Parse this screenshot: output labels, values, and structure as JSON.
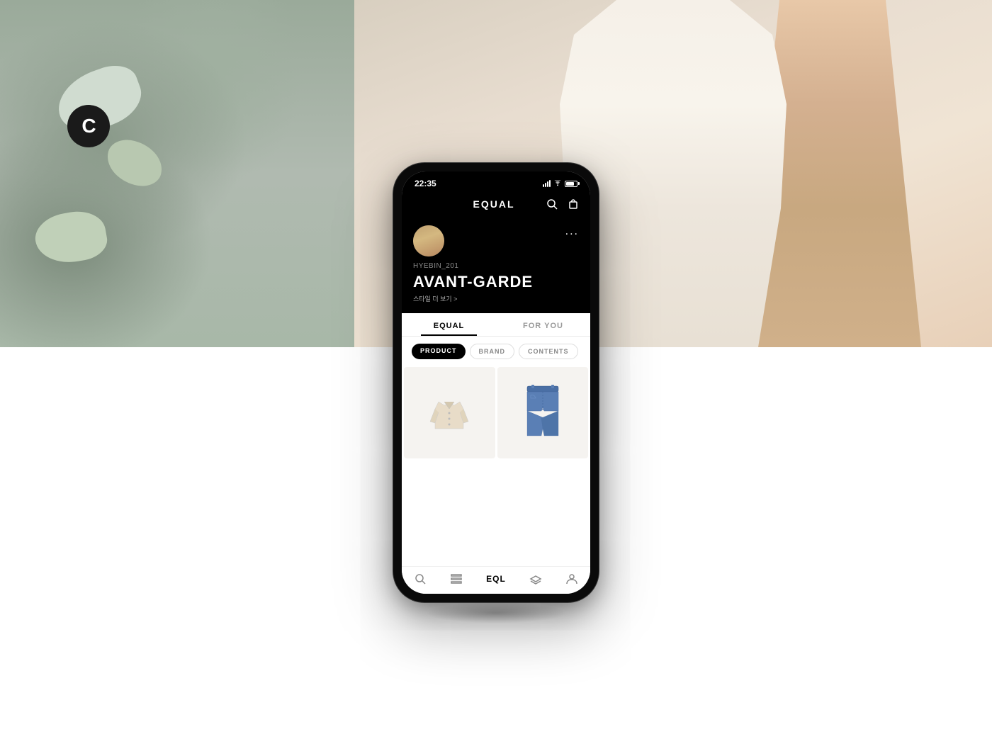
{
  "hero": {
    "background_desc": "Fashion editorial background with peeling concrete wall and person in white dress"
  },
  "c_logo": {
    "letter": "C"
  },
  "phone": {
    "status_bar": {
      "time": "22:35"
    },
    "app_header": {
      "title": "EQUAL",
      "search_label": "search",
      "cart_label": "cart"
    },
    "profile": {
      "username": "HYEBIN_201",
      "style_name": "AVANT-GARDE",
      "view_more": "스타일 더 보기 >",
      "more_options": "..."
    },
    "tabs": [
      {
        "label": "EQUAL",
        "active": true
      },
      {
        "label": "FOR YOU",
        "active": false
      }
    ],
    "filters": [
      {
        "label": "PRODUCT",
        "active": true
      },
      {
        "label": "BRAND",
        "active": false
      },
      {
        "label": "CONTENTS",
        "active": false
      }
    ],
    "products": [
      {
        "type": "jacket",
        "color": "cream"
      },
      {
        "type": "jeans",
        "color": "blue"
      }
    ],
    "bottom_nav": [
      {
        "icon": "search",
        "label": "search"
      },
      {
        "icon": "list",
        "label": "feed"
      },
      {
        "icon": "logo",
        "label": "EQL"
      },
      {
        "icon": "layers",
        "label": "stack"
      },
      {
        "icon": "user",
        "label": "profile"
      }
    ]
  }
}
